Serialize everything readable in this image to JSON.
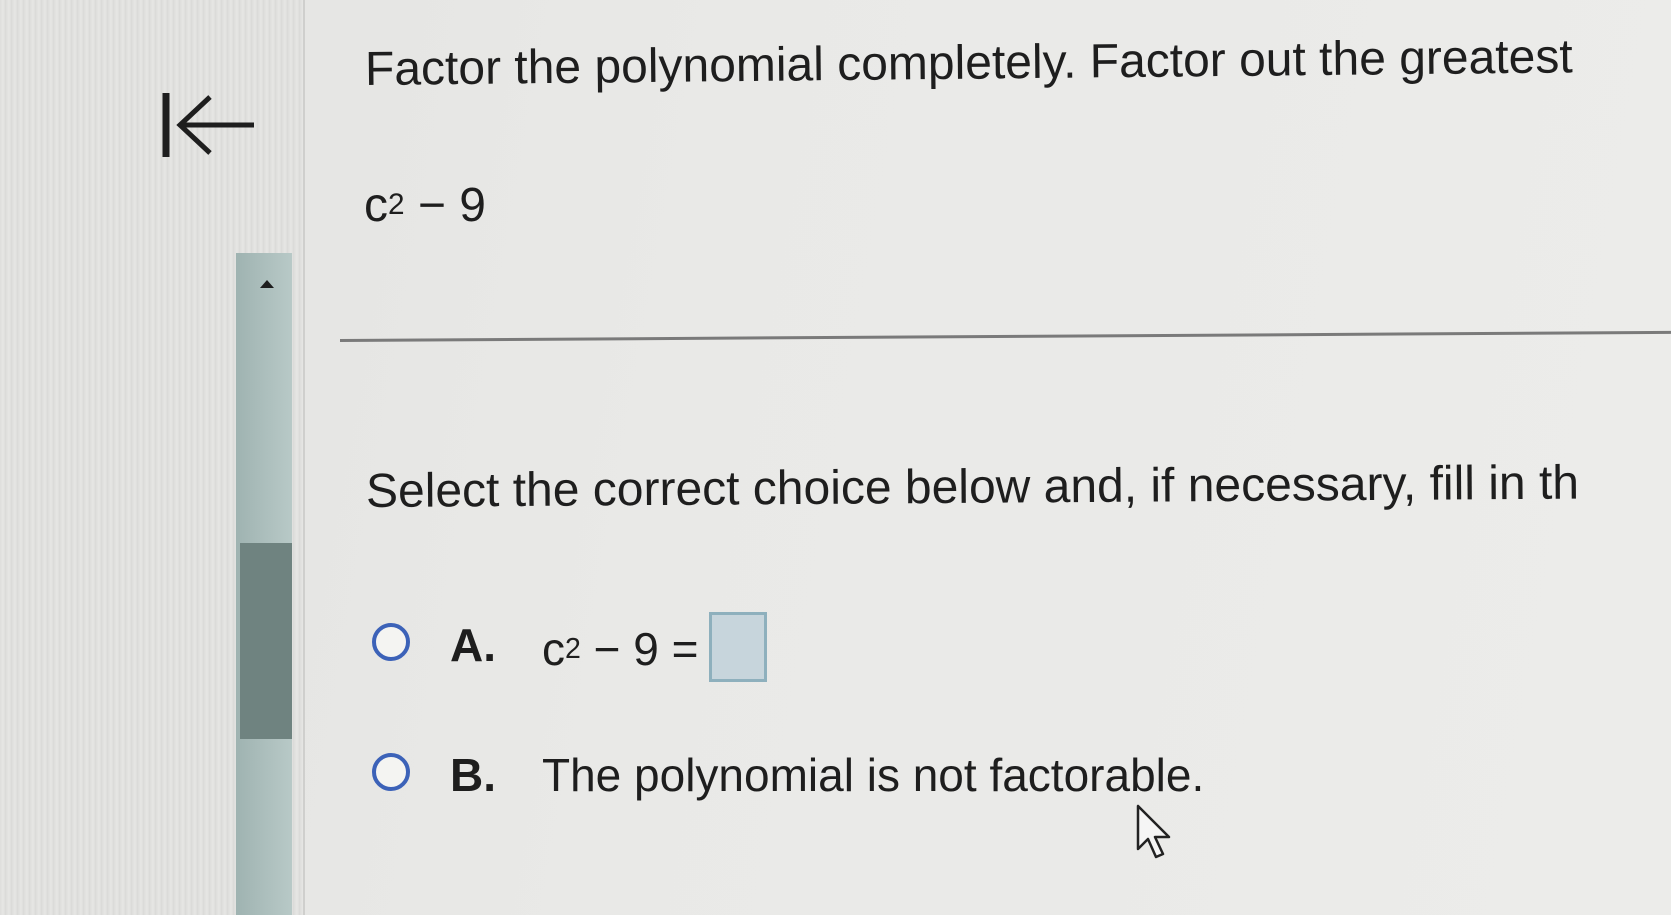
{
  "question": {
    "title": "Factor the polynomial completely. Factor out the greatest",
    "polynomial": {
      "base": "c",
      "exponent": "2",
      "rest": " − 9"
    }
  },
  "instruction": "Select the correct choice below and, if necessary, fill in th",
  "choices": [
    {
      "letter": "A.",
      "expr_base": "c",
      "expr_exponent": "2",
      "expr_rest": " − 9 =",
      "answer_value": ""
    },
    {
      "letter": "B.",
      "text": "The polynomial is not factorable."
    }
  ],
  "icons": {
    "back": "back-to-start-icon",
    "scroll_up": "scroll-up-arrow-icon",
    "cursor": "mouse-pointer-icon"
  },
  "colors": {
    "radio": "#3c62b8",
    "answer_box": "#c7d5dc",
    "scrollbar_thumb": "#6f8380"
  }
}
